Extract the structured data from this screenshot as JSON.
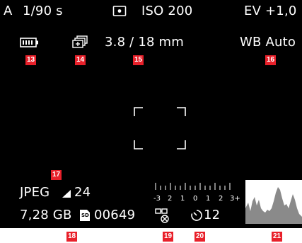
{
  "top_bar": {
    "mode": "A",
    "shutter": "1/90 s",
    "metering_icon": "spot-metering-icon",
    "iso": "ISO 200",
    "ev": "EV +1,0"
  },
  "second_row": {
    "battery_icon": "battery-icon",
    "drive_icon": "continuous-shooting-icon",
    "lens": "3.8 / 18 mm",
    "white_balance": "WB Auto"
  },
  "badges": {
    "b13": "13",
    "b14": "14",
    "b15": "15",
    "b16": "16",
    "b17": "17",
    "b18": "18",
    "b19": "19",
    "b20": "20",
    "b21": "21"
  },
  "bottom_info": {
    "format": "JPEG",
    "resolution": "24",
    "capacity": "7,28 GB",
    "card_label": "SD",
    "remaining_shots": "00649",
    "self_timer": "12"
  },
  "exposure_scale": {
    "labels": [
      "-3",
      "2",
      "1",
      "0",
      "1",
      "2",
      "3+"
    ]
  },
  "colors": {
    "badge": "#e8202a",
    "screen": "#000000",
    "text": "#ffffff"
  }
}
